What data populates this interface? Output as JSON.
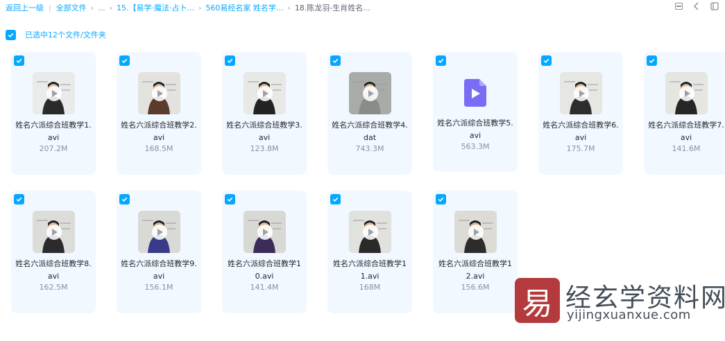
{
  "breadcrumb": {
    "back": "返回上一级",
    "all_files": "全部文件",
    "ellipsis": "...",
    "items": [
      "15.【易学·魔法·占卜...",
      "560易经名家 姓名学...",
      "18.陈龙羽-生肖姓名..."
    ]
  },
  "top_icons": [
    "list-view-icon",
    "chevron-left-icon",
    "collapse-icon"
  ],
  "selection": {
    "text": "已选中12个文件/文件夹",
    "checked": true
  },
  "files": [
    {
      "name": "姓名六派综合班教学1.avi",
      "size": "207.2M",
      "thumb": "video"
    },
    {
      "name": "姓名六派综合班教学2.avi",
      "size": "168.5M",
      "thumb": "video"
    },
    {
      "name": "姓名六派综合班教学3.avi",
      "size": "123.8M",
      "thumb": "video"
    },
    {
      "name": "姓名六派综合班教学4.dat",
      "size": "743.3M",
      "thumb": "video"
    },
    {
      "name": "姓名六派综合班教学5.avi",
      "size": "563.3M",
      "thumb": "video-file-icon"
    },
    {
      "name": "姓名六派综合班教学6.avi",
      "size": "175.7M",
      "thumb": "video"
    },
    {
      "name": "姓名六派综合班教学7.avi",
      "size": "141.6M",
      "thumb": "video"
    },
    {
      "name": "姓名六派综合班教学8.avi",
      "size": "162.5M",
      "thumb": "video"
    },
    {
      "name": "姓名六派综合班教学9.avi",
      "size": "156.1M",
      "thumb": "video"
    },
    {
      "name": "姓名六派综合班教学10.avi",
      "size": "141.4M",
      "thumb": "video"
    },
    {
      "name": "姓名六派综合班教学11.avi",
      "size": "168M",
      "thumb": "video"
    },
    {
      "name": "姓名六派综合班教学12.avi",
      "size": "156.6M",
      "thumb": "video"
    }
  ],
  "watermark": {
    "logo_char": "易",
    "title": "经玄学资料网",
    "url": "yijingxuanxue.com"
  },
  "colors": {
    "accent": "#06a7ff",
    "card_bg": "#f1f8ff",
    "watermark_red": "#b43a3e"
  }
}
